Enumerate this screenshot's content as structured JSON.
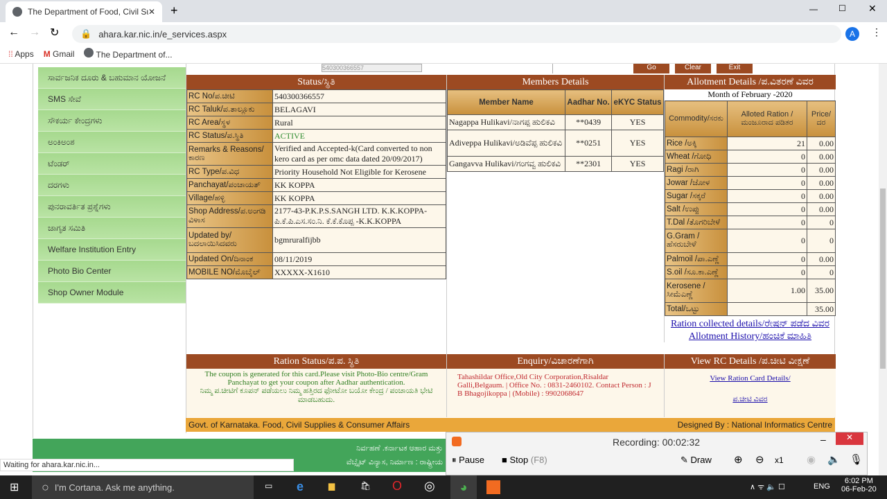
{
  "browser": {
    "tab_title": "The Department of Food, Civil Su",
    "url": "ahara.kar.nic.in/e_services.aspx",
    "bookmarks": [
      "Apps",
      "Gmail",
      "The Department of..."
    ],
    "status_text": "Waiting for ahara.kar.nic.in...",
    "profile_initial": "A"
  },
  "sidebar": {
    "items": [
      "ಸಾರ್ವಜನಿಕ ದೂರು & ಬಹುಮಾನ ಯೋಜನೆ",
      "SMS ಸೇವೆ",
      "ಸೌಕರ್ಯ ಕೇಂದ್ರಗಳು",
      "ಅಂಕಿಅಂಶ",
      "ಟೆಂಡರ್",
      "ದರಗಳು",
      "ಪುನರಾವರ್ತಿತ ಪ್ರಶ್ನೆಗಳು",
      "ಜಾಗೃತ ಸಮಿತಿ",
      "Welfare Institution Entry",
      "Photo Bio Center",
      "Shop Owner Module"
    ]
  },
  "top_buttons": [
    "Go",
    "Clear",
    "Exit"
  ],
  "rc_input": "540300366557",
  "status": {
    "title": "Status/ಸ್ಥಿತಿ",
    "rows": [
      [
        "RC No/ಪ.ಚೀಟಿ",
        "540300366557"
      ],
      [
        "RC Taluk/ಪ.ತಾಲ್ಲೂಕು",
        "BELAGAVI"
      ],
      [
        "RC Area/ಸ್ಥಳ",
        "Rural"
      ],
      [
        "RC Status/ಪ.ಸ್ಥಿತಿ",
        "ACTIVE"
      ],
      [
        "Remarks & Reasons/ ಕಾರಣ",
        "Verified and Accepted-k(Card converted to non kero card as per omc data dated 20/09/2017)"
      ],
      [
        "RC Type/ಪ.ವಿಧ",
        "Priority Household Not Eligible for Kerosene"
      ],
      [
        "Panchayat/ಪಂಚಾಯತ್",
        "KK KOPPA"
      ],
      [
        "Village/ಹಳ್ಳಿ",
        "KK KOPPA"
      ],
      [
        "Shop Address/ಪ.ಅಂಗಡಿ ವಿಳಾಸ",
        "2177-43-P.K.P.S.SANGH LTD. K.K.KOPPA-ಪಿ.ಕೆ.ಪಿ.ಎಸ.ಸಂ.ನಿ. ಕೆ.ಕೆ.ಕೊಪ್ಪ -K.K.KOPPA"
      ],
      [
        "Updated by/ ಬದಲಾಯಿಸಿದವರು",
        "bgmruralfijbb"
      ],
      [
        "Updated On/ದಿನಾಂಕ",
        "08/11/2019"
      ],
      [
        "MOBILE NO/ಮೊಬೈಲ್",
        "XXXXX-X1610"
      ]
    ],
    "active_color": "#2e8b2e"
  },
  "members": {
    "title": "Members Details",
    "headers": [
      "Member Name",
      "Aadhar No.",
      "eKYC Status"
    ],
    "rows": [
      [
        "Nagappa Hulikavi/ನಾಗಪ್ಪ ಹುಲಿಕವಿ",
        "**0439",
        "YES"
      ],
      [
        "Adiveppa Hulikavi/ಅಡಿವೆಪ್ಪ ಹುಲಿಕವಿ",
        "**0251",
        "YES"
      ],
      [
        "Gangavva Hulikavi/ಗಂಗವ್ವ ಹುಲಿಕವಿ",
        "**2301",
        "YES"
      ]
    ]
  },
  "allotment": {
    "title": "Allotment Details /ಪ.ವಿತರಣೆ ವಿವರ",
    "month": "Month of February -2020",
    "headers": [
      "Commodity/ಸರಕು",
      "Alloted Ration /ಮಂಜೂರಾದ ಪಡಿತರ",
      "Price/ದರ"
    ],
    "rows": [
      [
        "Rice /ಅಕ್ಕಿ",
        "21",
        "0.00"
      ],
      [
        "Wheat /ಗೋಧಿ",
        "0",
        "0.00"
      ],
      [
        "Ragi /ರಾಗಿ",
        "0",
        "0.00"
      ],
      [
        "Jowar /ಜೋಳ",
        "0",
        "0.00"
      ],
      [
        "Sugar /ಸಕ್ಕರೆ",
        "0",
        "0.00"
      ],
      [
        "Salt /ಉಪ್ಪು",
        "0",
        "0.00"
      ],
      [
        "T.Dal /ತೊಗರಿಬೇಳೆ",
        "0",
        "0"
      ],
      [
        "G.Gram / ಹೆಸರುಬೇಳೆ",
        "0",
        "0"
      ],
      [
        "Palmoil /ಪಾ.ಎಣ್ಣೆ",
        "0",
        "0.00"
      ],
      [
        "S.oil /ಸೂ.ಕಾ.ಎಣ್ಣೆ",
        "0",
        "0"
      ],
      [
        "Kerosene / ಸೀಮೆಎಣ್ಣೆ",
        "1.00",
        "35.00"
      ],
      [
        "Total/ಒಟ್ಟು",
        "",
        "35.00"
      ]
    ],
    "link1": "Ration collected details/ರೇಷನ್ ಪಡೆದ ವಿವರ",
    "link2": "Allotment History/ಹಂಚಿಕೆ ಮಾಹಿತಿ"
  },
  "ration_status": {
    "title": "Ration Status/ಪ.ಪ. ಸ್ಥಿತಿ",
    "text": "The coupon is generated for this card.Please visit Photo-Bio centre/Gram Panchayat to get your coupon after Aadhar authentication.",
    "text_kn": "ನಿಮ್ಮ ಪ.ಚೀಟಿಗೆ ಕೂಪನ್ ಪಡೆಯಲು ನಿಮ್ಮ ಹತ್ತಿರದ ಫೋಟೋ ಬಯೋ ಕೇಂದ್ರ / ಪಂಚಾಯತಿ ಭೇಟಿ ಮಾಡಬಹುದು."
  },
  "enquiry": {
    "title": "Enquiry/ವಿಚಾರಣೆಗಾಗಿ",
    "text": "Tahashildar Office,Old City Corporation,Risaldar Galli,Belgaum. | Office No. : 0831-2460102. Contact Person : J B Bhagojikoppa | (Mobile) : 9902068647"
  },
  "view_rc": {
    "title": "View RC Details /ಪ.ಚೀಟಿ ವೀಕ್ಷಣೆ",
    "link1": "View Ration Card Details/",
    "link2": "ಪ.ಚೀಟಿ ವಿವರ"
  },
  "footer": {
    "left": "Govt. of Karnataka. Food, Civil Supplies & Consumer Affairs",
    "right": "Designed By : National Informatics Centre",
    "green1": "ನಿರ್ವಹಣೆ .ಕರ್ನಾಟಕ ಆಹಾರ ಮತ್ತು",
    "green2": "ವೆಬ್ಸೈಟ್ ವಿನ್ಯಾಸ, ನಿರ್ಮಾಣ : ರಾಷ್ಟ್ರೀಯ"
  },
  "recorder": {
    "label": "Recording:",
    "time": "00:02:32",
    "pause": "Pause",
    "stop": "Stop",
    "stop_key": "(F8)",
    "draw": "Draw",
    "zoom": "x1"
  },
  "taskbar": {
    "cortana": "I'm Cortana. Ask me anything.",
    "time": "6:02 PM",
    "date": "06-Feb-20",
    "lang": "ENG"
  }
}
